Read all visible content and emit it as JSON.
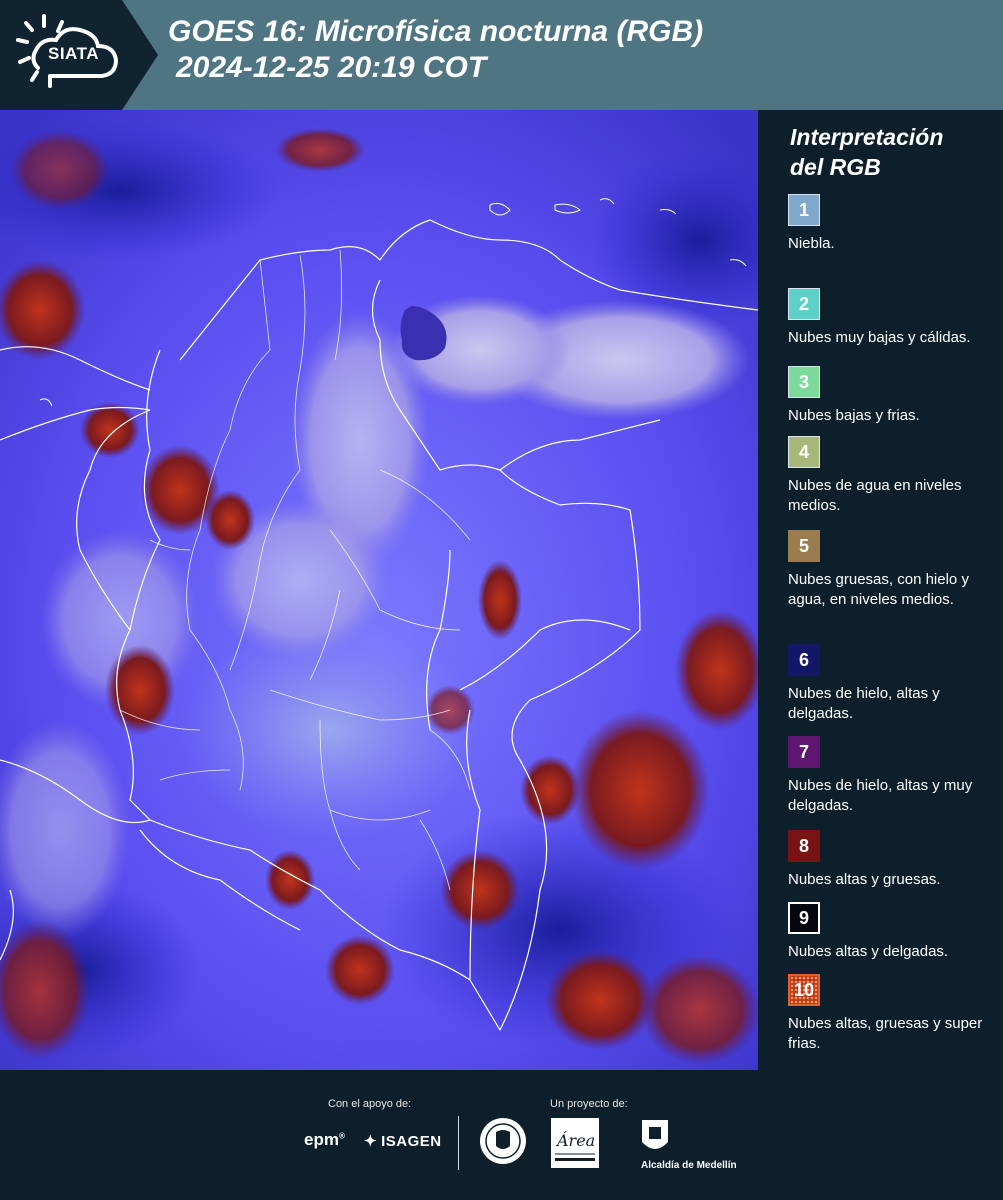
{
  "header": {
    "logo_text": "SIATA",
    "title_line1": "GOES 16: Microfísica nocturna (RGB)",
    "title_line2": "2024-12-25 20:19 COT"
  },
  "legend": {
    "title_line1": "Interpretación",
    "title_line2": "del RGB",
    "items": [
      {
        "number": "1",
        "label": "Niebla.",
        "color": "#7fa8cc"
      },
      {
        "number": "2",
        "label": "Nubes muy bajas y cálidas.",
        "color": "#5fd0c8"
      },
      {
        "number": "3",
        "label": "Nubes bajas y frias.",
        "color": "#7ed99c"
      },
      {
        "number": "4",
        "label": "Nubes de agua en niveles medios.",
        "color": "#a8b77a"
      },
      {
        "number": "5",
        "label": "Nubes gruesas, con hielo y agua, en niveles medios.",
        "color": "#9a7d4e"
      },
      {
        "number": "6",
        "label": "Nubes de hielo, altas y delgadas.",
        "color": "#141766"
      },
      {
        "number": "7",
        "label": "Nubes de hielo, altas y muy delgadas.",
        "color": "#5e1670"
      },
      {
        "number": "8",
        "label": "Nubes altas y gruesas.",
        "color": "#7a1414"
      },
      {
        "number": "9",
        "label": "Nubes altas y delgadas.",
        "color": "#06060f"
      },
      {
        "number": "10",
        "label": "Nubes altas, gruesas y super frias.",
        "color": "#c0341a"
      }
    ]
  },
  "footer": {
    "support_label": "Con el apoyo de:",
    "project_label": "Un proyecto de:",
    "epm": "epm",
    "isagen": "ISAGEN",
    "alcaldia": "Alcaldía de Medellín",
    "area_text": "Área"
  }
}
